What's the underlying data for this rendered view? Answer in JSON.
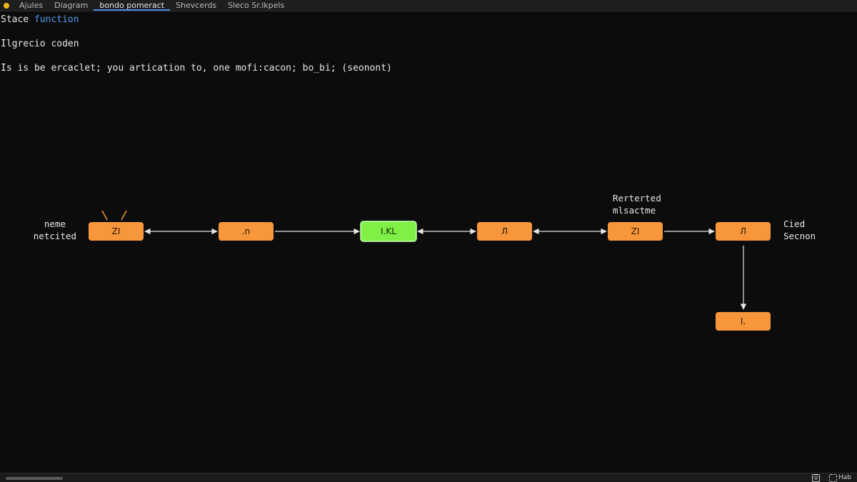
{
  "tabs": [
    {
      "label": "Ajules"
    },
    {
      "label": "Diagram"
    },
    {
      "label": "bondo pomeract"
    },
    {
      "label": "Shevcerds"
    },
    {
      "label": "Sleco Sr.lkpels"
    }
  ],
  "code": {
    "line1_prefix": "Stace ",
    "line1_keyword": "function",
    "line2": "Ilgrecio coden",
    "line3": "Is is be ercaclet; you artication to, one mofi:cacon; bo_bi; (seonont)"
  },
  "diagram": {
    "left_label": [
      "neme",
      "netcited"
    ],
    "top_label": [
      "Rerterted",
      "mlsactme"
    ],
    "right_label": [
      "Cied",
      "Secnon"
    ],
    "nodes": [
      {
        "id": "n1",
        "label": "ZI",
        "color": "#f7963a"
      },
      {
        "id": "n2",
        "label": ".n",
        "color": "#f7963a"
      },
      {
        "id": "n3",
        "label": "I.KL",
        "color": "#7ef046"
      },
      {
        "id": "n4",
        "label": "Л",
        "color": "#f7963a"
      },
      {
        "id": "n5",
        "label": "ZI",
        "color": "#f7963a"
      },
      {
        "id": "n6",
        "label": "Л",
        "color": "#f7963a"
      },
      {
        "id": "n7",
        "label": "I.",
        "color": "#f7963a"
      }
    ]
  },
  "status": {
    "icon1": "@",
    "right_text": "Hab"
  },
  "colors": {
    "accent": "#4f9cf0",
    "node_orange": "#f7963a",
    "node_green": "#7ef046",
    "background": "#0c0c0c"
  }
}
